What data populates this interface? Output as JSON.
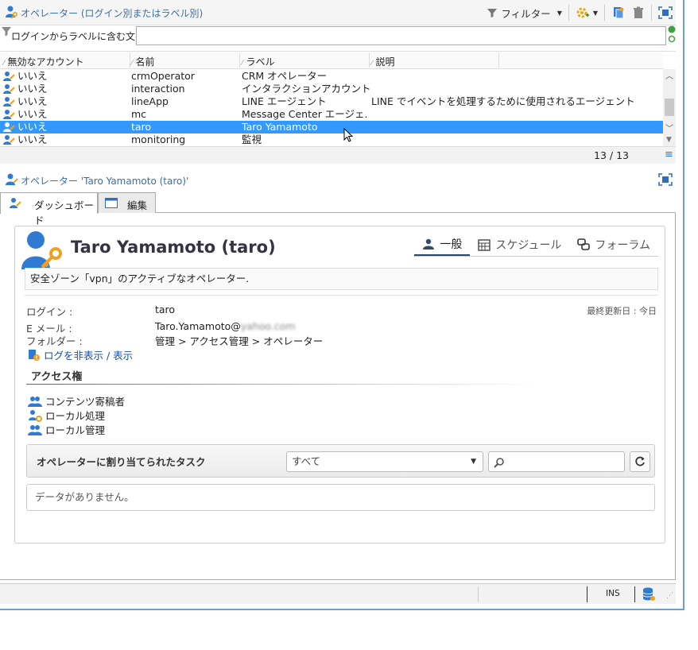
{
  "top_panel": {
    "title": "オペレーター (ログイン別またはラベル別)",
    "toolbar": {
      "filter_label": "フィルター"
    }
  },
  "filter": {
    "label": "ログインからラベルに含む文字:",
    "value": "",
    "placeholder": ""
  },
  "grid": {
    "columns": [
      "無効なアカウント",
      "名前",
      "ラベル",
      "説明"
    ],
    "rows": [
      {
        "disabled": "いいえ",
        "name": "crmOperator",
        "label": "CRM オペレーター",
        "description": ""
      },
      {
        "disabled": "いいえ",
        "name": "interaction",
        "label": "インタラクションアカウント",
        "description": ""
      },
      {
        "disabled": "いいえ",
        "name": "lineApp",
        "label": "LINE エージェント",
        "description": "LINE でイベントを処理するために使用されるエージェント"
      },
      {
        "disabled": "いいえ",
        "name": "mc",
        "label": "Message Center エージェ...",
        "description": ""
      },
      {
        "disabled": "いいえ",
        "name": "taro",
        "label": "Taro Yamamoto",
        "description": "",
        "selected": true
      },
      {
        "disabled": "いいえ",
        "name": "monitoring",
        "label": "監視",
        "description": ""
      }
    ],
    "pager": "13 / 13"
  },
  "detail": {
    "title": "オペレーター 'Taro Yamamoto (taro)'",
    "tabs": [
      "ダッシュボード",
      "編集"
    ]
  },
  "card": {
    "user_name": "Taro Yamamoto (taro)",
    "view_tabs": [
      "一般",
      "スケジュール",
      "フォーラム"
    ],
    "summary": "安全ゾーン「vpn」のアクティブなオペレーター.",
    "fields": {
      "login_label": "ログイン :",
      "login_value": "taro",
      "email_label": "E メール :",
      "email_value": "Taro.Yamamoto@",
      "email_domain": "yahoo.com",
      "folder_label": "フォルダー :",
      "folder_value": "管理 > アクセス管理 > オペレーター"
    },
    "updated": "最終更新日 : 今日",
    "log_link": "ログを非表示 / 表示",
    "access_title": "アクセス権",
    "permissions": [
      "コンテンツ寄稿者",
      "ローカル処理",
      "ローカル管理"
    ],
    "tasks": {
      "title": "オペレーターに割り当てられたタスク",
      "select_value": "すべて",
      "empty": "データがありません。"
    }
  },
  "statusbar": {
    "ins": "INS"
  },
  "colors": {
    "accent": "#3a6ea5",
    "selection": "#3399ff",
    "icon_blue": "#2f7bd1",
    "icon_orange": "#f0a020"
  }
}
